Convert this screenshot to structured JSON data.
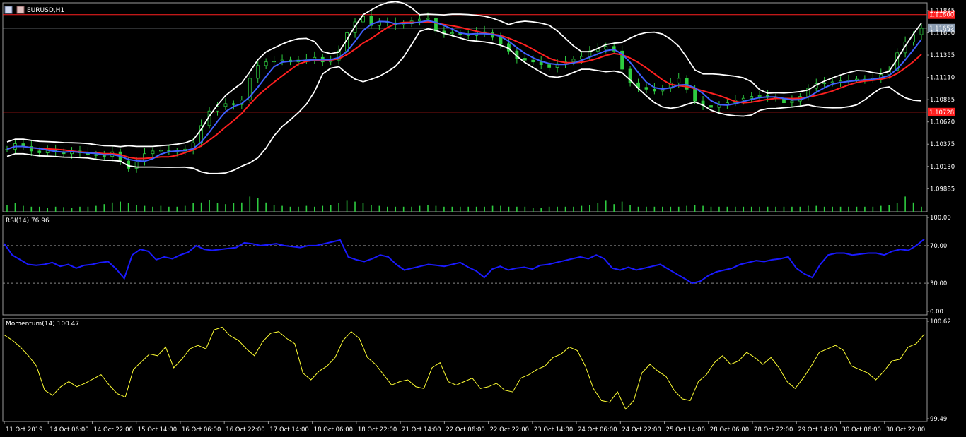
{
  "window": {
    "symbol_title": "EURUSD,H1"
  },
  "colors": {
    "background": "#000000",
    "candles": "#2ecc40",
    "volume": "#2ecc40",
    "sma_fast": "#4060ff",
    "sma_slow": "#ff2020",
    "bollinger": "#ffffff",
    "hline": "#ff2020",
    "rsi_line": "#1a1aff",
    "momentum_line": "#ffff33",
    "grid_level": "#888888",
    "price_tag_red": "#ff2020",
    "price_tag_gray": "#8a9bb0"
  },
  "chart_data": [
    {
      "type": "candlestick",
      "pane": "main",
      "title": "EURUSD,H1",
      "y_ticks": [
        "1.11845",
        "1.11600",
        "1.11355",
        "1.11110",
        "1.10865",
        "1.10620",
        "1.10375",
        "1.10130",
        "1.09885"
      ],
      "y_tick_values": [
        1.11845,
        1.116,
        1.11355,
        1.1111,
        1.10865,
        1.1062,
        1.10375,
        1.1013,
        1.09885
      ],
      "ylim": [
        1.0974,
        1.1193
      ],
      "horizontal_levels": [
        {
          "label": "1.11800",
          "value": 1.118,
          "color": "#ff2020"
        },
        {
          "label": "1.10728",
          "value": 1.10728,
          "color": "#ff2020"
        }
      ],
      "bid_line": {
        "label": "1.11652",
        "value": 1.11652
      },
      "close_series": [
        1.1032,
        1.1038,
        1.1035,
        1.103,
        1.1028,
        1.1031,
        1.1029,
        1.1027,
        1.103,
        1.1028,
        1.1026,
        1.1025,
        1.1024,
        1.1029,
        1.1019,
        1.1011,
        1.1018,
        1.1027,
        1.103,
        1.1031,
        1.1029,
        1.103,
        1.1032,
        1.1039,
        1.1058,
        1.1074,
        1.1079,
        1.1082,
        1.1081,
        1.1086,
        1.111,
        1.1124,
        1.1128,
        1.1129,
        1.113,
        1.1128,
        1.113,
        1.1131,
        1.1133,
        1.1128,
        1.113,
        1.114,
        1.116,
        1.1172,
        1.1178,
        1.1168,
        1.1172,
        1.1171,
        1.1169,
        1.117,
        1.1173,
        1.1175,
        1.1176,
        1.1162,
        1.1159,
        1.116,
        1.1158,
        1.1157,
        1.1161,
        1.116,
        1.1155,
        1.1148,
        1.114,
        1.1132,
        1.113,
        1.1128,
        1.1125,
        1.1122,
        1.1126,
        1.1128,
        1.1131,
        1.1134,
        1.114,
        1.1142,
        1.1145,
        1.114,
        1.112,
        1.1105,
        1.11,
        1.1098,
        1.1096,
        1.1099,
        1.1105,
        1.111,
        1.1098,
        1.1085,
        1.108,
        1.1078,
        1.1081,
        1.1083,
        1.1086,
        1.1088,
        1.109,
        1.1091,
        1.1089,
        1.1088,
        1.1083,
        1.1085,
        1.109,
        1.1099,
        1.1104,
        1.1105,
        1.1106,
        1.1107,
        1.1108,
        1.1109,
        1.1109,
        1.111,
        1.1114,
        1.1119,
        1.1138,
        1.115,
        1.1158,
        1.1165
      ],
      "volume_relative": [
        0.4,
        0.5,
        0.35,
        0.3,
        0.3,
        0.25,
        0.3,
        0.28,
        0.25,
        0.3,
        0.3,
        0.35,
        0.45,
        0.55,
        0.6,
        0.5,
        0.4,
        0.35,
        0.3,
        0.35,
        0.3,
        0.3,
        0.35,
        0.5,
        0.55,
        0.7,
        0.5,
        0.45,
        0.5,
        0.55,
        0.9,
        0.8,
        0.55,
        0.4,
        0.35,
        0.3,
        0.3,
        0.35,
        0.3,
        0.35,
        0.4,
        0.5,
        0.65,
        0.6,
        0.5,
        0.4,
        0.35,
        0.3,
        0.3,
        0.3,
        0.3,
        0.35,
        0.4,
        0.35,
        0.3,
        0.3,
        0.3,
        0.3,
        0.3,
        0.3,
        0.35,
        0.35,
        0.3,
        0.3,
        0.3,
        0.25,
        0.25,
        0.3,
        0.3,
        0.3,
        0.3,
        0.35,
        0.4,
        0.5,
        0.65,
        0.45,
        0.6,
        0.4,
        0.3,
        0.3,
        0.3,
        0.3,
        0.3,
        0.3,
        0.35,
        0.4,
        0.35,
        0.3,
        0.3,
        0.3,
        0.3,
        0.3,
        0.3,
        0.3,
        0.3,
        0.3,
        0.3,
        0.3,
        0.3,
        0.35,
        0.35,
        0.3,
        0.3,
        0.3,
        0.3,
        0.3,
        0.3,
        0.3,
        0.35,
        0.4,
        0.5,
        0.9,
        0.55,
        0.3
      ]
    },
    {
      "type": "line",
      "pane": "rsi",
      "title": "RSI(14) 76.96",
      "y_ticks": [
        "100.00",
        "70.00",
        "30.00",
        "0.00"
      ],
      "y_tick_values": [
        100,
        70,
        30,
        0
      ],
      "ylim": [
        0,
        100
      ],
      "levels": [
        70,
        30
      ],
      "series": [
        {
          "values": [
            72,
            60,
            55,
            50,
            49,
            50,
            52,
            48,
            50,
            46,
            49,
            50,
            52,
            53,
            45,
            35,
            60,
            66,
            64,
            55,
            58,
            56,
            60,
            63,
            70,
            66,
            65,
            66,
            67,
            68,
            73,
            72,
            70,
            71,
            72,
            70,
            69,
            68,
            70,
            70,
            72,
            74,
            76,
            58,
            55,
            53,
            56,
            60,
            58,
            50,
            44,
            46,
            48,
            50,
            49,
            48,
            50,
            52,
            47,
            43,
            36,
            45,
            48,
            44,
            46,
            47,
            45,
            49,
            50,
            52,
            54,
            56,
            58,
            56,
            60,
            56,
            46,
            44,
            47,
            44,
            46,
            48,
            50,
            45,
            40,
            35,
            30,
            32,
            38,
            42,
            44,
            46,
            50,
            52,
            54,
            53,
            55,
            56,
            58,
            46,
            40,
            36,
            50,
            60,
            62,
            62,
            60,
            61,
            62,
            62,
            60,
            64,
            66,
            65,
            70,
            77
          ]
        }
      ]
    },
    {
      "type": "line",
      "pane": "momentum",
      "title": "Momentum(14) 100.47",
      "y_ticks": [
        "100.62",
        "99.49"
      ],
      "y_tick_values": [
        100.62,
        99.49
      ],
      "ylim": [
        99.49,
        100.62
      ],
      "series": [
        {
          "values": [
            100.46,
            100.4,
            100.32,
            100.22,
            100.1,
            99.82,
            99.76,
            99.86,
            99.92,
            99.86,
            99.9,
            99.95,
            100.0,
            99.88,
            99.78,
            99.74,
            100.06,
            100.15,
            100.24,
            100.22,
            100.32,
            100.08,
            100.18,
            100.3,
            100.34,
            100.3,
            100.52,
            100.55,
            100.45,
            100.4,
            100.3,
            100.22,
            100.38,
            100.48,
            100.5,
            100.42,
            100.36,
            100.02,
            99.94,
            100.04,
            100.1,
            100.2,
            100.4,
            100.5,
            100.42,
            100.2,
            100.12,
            100.0,
            99.88,
            99.92,
            99.94,
            99.86,
            99.84,
            100.08,
            100.14,
            99.92,
            99.88,
            99.92,
            99.96,
            99.84,
            99.86,
            99.9,
            99.82,
            99.8,
            99.96,
            100.0,
            100.06,
            100.1,
            100.2,
            100.24,
            100.32,
            100.28,
            100.1,
            99.84,
            99.7,
            99.68,
            99.8,
            99.6,
            99.7,
            100.02,
            100.12,
            100.04,
            99.98,
            99.82,
            99.72,
            99.7,
            99.92,
            100.0,
            100.14,
            100.22,
            100.12,
            100.16,
            100.26,
            100.2,
            100.12,
            100.2,
            100.08,
            99.92,
            99.84,
            99.96,
            100.1,
            100.26,
            100.3,
            100.34,
            100.28,
            100.1,
            100.06,
            100.02,
            99.94,
            100.04,
            100.16,
            100.18,
            100.32,
            100.36,
            100.47
          ]
        }
      ]
    }
  ],
  "x_axis": {
    "labels": [
      "11 Oct 2019",
      "14 Oct 06:00",
      "14 Oct 22:00",
      "15 Oct 14:00",
      "16 Oct 06:00",
      "16 Oct 22:00",
      "17 Oct 14:00",
      "18 Oct 06:00",
      "18 Oct 22:00",
      "21 Oct 14:00",
      "22 Oct 06:00",
      "22 Oct 22:00",
      "23 Oct 14:00",
      "24 Oct 06:00",
      "24 Oct 22:00",
      "25 Oct 14:00",
      "28 Oct 06:00",
      "28 Oct 22:00",
      "29 Oct 14:00",
      "30 Oct 06:00",
      "30 Oct 22:00"
    ]
  }
}
